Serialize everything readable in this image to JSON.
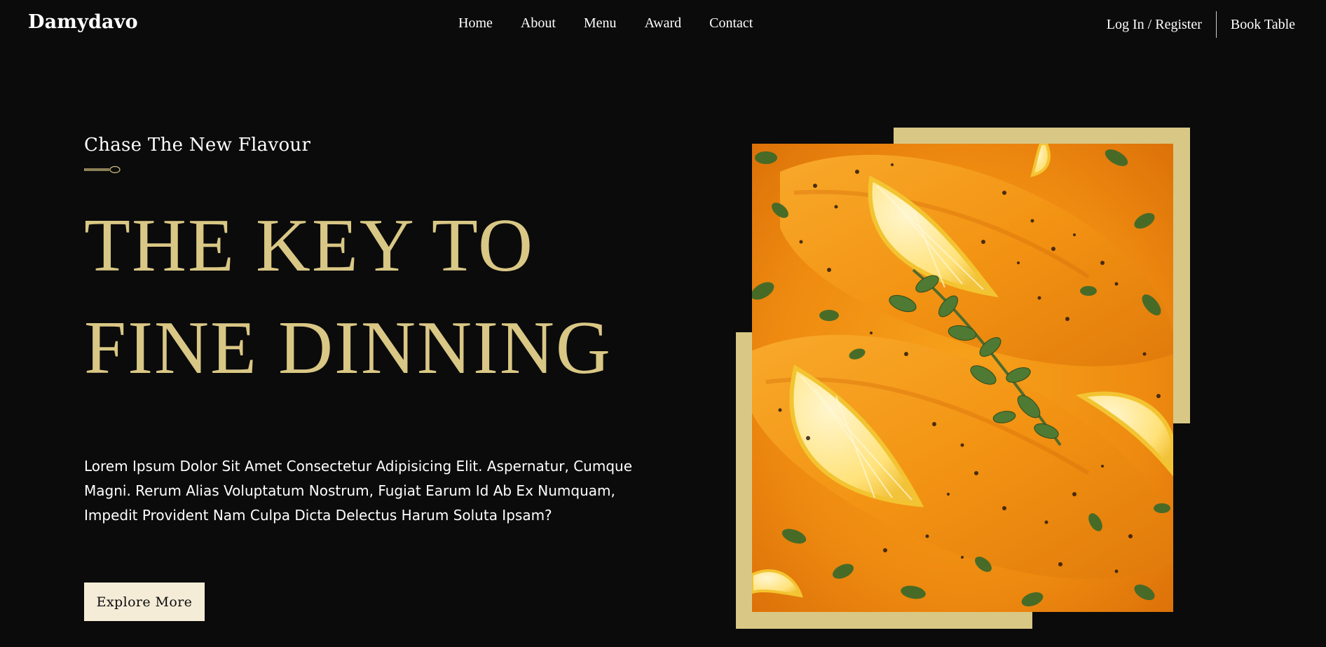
{
  "brand": "Damydavo",
  "nav": {
    "items": [
      "Home",
      "About",
      "Menu",
      "Award",
      "Contact"
    ]
  },
  "auth": {
    "login_label": "Log In / Register",
    "book_label": "Book Table"
  },
  "hero": {
    "eyebrow": "Chase The New Flavour",
    "headline_line1": "THE KEY TO",
    "headline_line2": "FINE DINNING",
    "description": "Lorem Ipsum Dolor Sit Amet Consectetur Adipisicing Elit. Aspernatur, Cumque Magni. Rerum Alias Voluptatum Nostrum, Fugiat Earum Id Ab Ex Numquam, Impedit Provident Nam Culpa Dicta Delectus Harum Soluta Ipsam?",
    "cta_label": "Explore More",
    "image_name": "salmon-dish-image"
  },
  "colors": {
    "background": "#0b0b0b",
    "accent_gold": "#d9c785",
    "button_cream": "#f5ecd8",
    "text": "#ffffff"
  }
}
